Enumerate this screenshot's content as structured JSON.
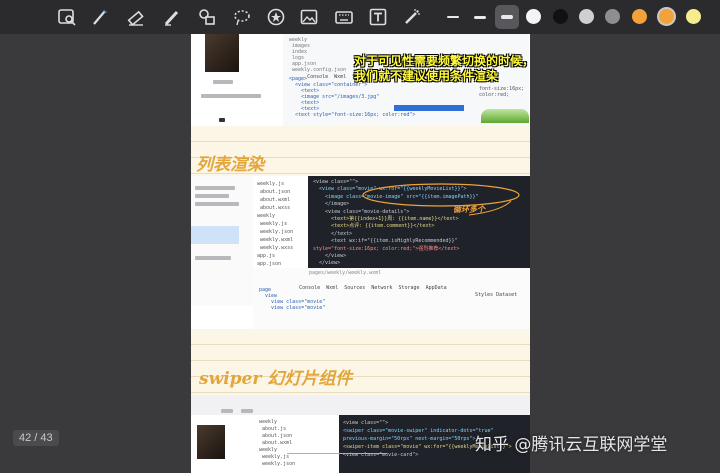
{
  "toolbar": {
    "tools": [
      "search-image-icon",
      "pen-icon",
      "eraser-icon",
      "highlighter-icon",
      "shapes-icon",
      "lasso-icon",
      "sticker-icon",
      "image-icon",
      "keyboard-icon",
      "text-box-icon",
      "pointer-icon"
    ],
    "line_widths": [
      "thin",
      "medium",
      "thick"
    ],
    "colors": [
      {
        "name": "white",
        "hex": "#f4f4f4"
      },
      {
        "name": "black",
        "hex": "#111111"
      },
      {
        "name": "light-gray",
        "hex": "#cfcfcf"
      },
      {
        "name": "gray",
        "hex": "#8e8e8e"
      },
      {
        "name": "orange",
        "hex": "#f3a23a"
      },
      {
        "name": "yellow",
        "hex": "#f6ec8e"
      }
    ],
    "selected_color": "orange"
  },
  "document": {
    "slide1": {
      "caption_line1": "对于可见性需要频繁切换的时候，",
      "caption_line2": "我们就不建议使用条件渲染",
      "tabs": [
        "Console",
        "Wxml",
        "Sources"
      ],
      "code": [
        "<page>",
        "  <view class=\"container\">",
        "    <text>",
        "    <image src=\"/images/3.jpg\"",
        "    <text>",
        "    <text>",
        "  <text style=\"font-size:16px; color:red\">"
      ]
    },
    "heading_list": "列表渲染",
    "slide2": {
      "code": [
        "<view class=\"\">",
        "  <view class=\"movie\" wx:for=\"{{weeklyMovieList}}\">",
        "    <image class=\"movie-image\" src=\"{{item.imagePath}}\"",
        "    </image>",
        "    <view class=\"movie-details\">",
        "      <text>第{{index+1}}周: {{item.name}}</text>",
        "      <text>点评: {{item.comment}}</text>",
        "      </text>",
        "      <text wx:if=\"{{item.isHighlyRecommended}}\"",
        "style=\"font-size:16px; color:red;\">强烈推荐</text>",
        "    </view>",
        "  </view>"
      ],
      "note": "循环多个",
      "path": "pages/weekly/weekly.wxml",
      "tabs": [
        "Console",
        "Wxml",
        "Sources",
        "Network",
        "Storage",
        "AppData"
      ],
      "styles_tab": "Styles",
      "dataset_tab": "Dataset",
      "tree": [
        "page",
        "view",
        "view class=\"movie\"",
        "view class=\"movie\""
      ]
    },
    "heading_swiper": "swiper 幻灯片组件",
    "slide3": {
      "code": [
        "<view class=\"\">",
        "<swiper class=\"movie-swiper\" indicator-dots=\"true\"",
        "previous-margin=\"50rpx\" next-margin=\"50rpx\">",
        "<swiper-item class=\"movie\" wx:for=\"{{weeklyMovieList}}\">",
        "<view class=\"movie-card\">"
      ]
    }
  },
  "page_counter": "42 / 43",
  "watermark": "知乎 @腾讯云互联网学堂"
}
